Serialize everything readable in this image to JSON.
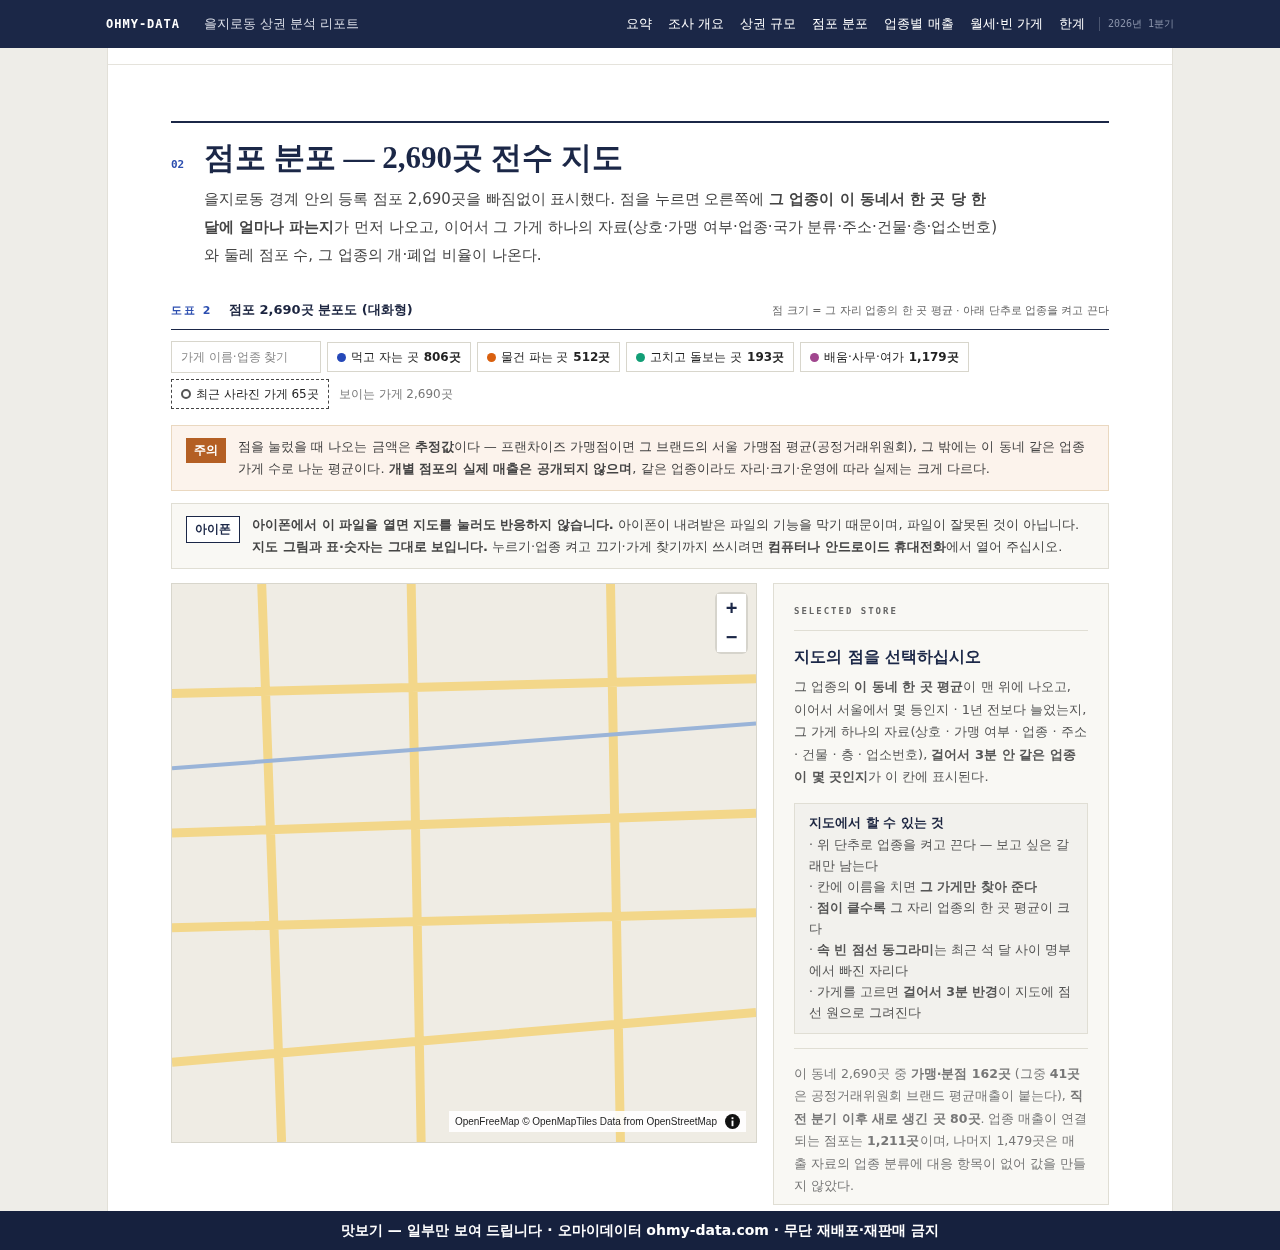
{
  "header": {
    "brand": "OHMY-DATA",
    "subtitle": "을지로동 상권 분석 리포트",
    "nav": [
      "요약",
      "조사 개요",
      "상권 규모",
      "점포 분포",
      "업종별 매출",
      "월세·빈 가게",
      "한계"
    ],
    "period": "2026년 1분기"
  },
  "section": {
    "number": "02",
    "title": "점포 분포 — 2,690곳 전수 지도",
    "intro": "을지로동 경계 안의 등록 점포 2,690곳을 빠짐없이 표시했다. 점을 누르면 오른쪽에 **그 업종이 이 동네서 한 곳 당 한 달에 얼마나 파는지**가 먼저 나오고, 이어서 그 가게 하나의 자료(상호·가맹 여부·업종·국가 분류·주소·건물·층·업소번호)와 둘레 점포 수, 그 업종의 개·폐업 비율이 나온다."
  },
  "figure": {
    "label": "도표 2",
    "title": "점포 2,690곳 분포도 (대화형)",
    "note": "점 크기 = 그 자리 업종의 한 곳 평균 · 아래 단추로 업종을 켜고 끈다"
  },
  "search": {
    "placeholder": "가게 이름·업종 찾기"
  },
  "filters": [
    {
      "kind": "category",
      "label": "먹고 자는 곳",
      "count": "806곳",
      "color": "#2548b8"
    },
    {
      "kind": "category",
      "label": "물건 파는 곳",
      "count": "512곳",
      "color": "#d9600f"
    },
    {
      "kind": "category",
      "label": "고치고 돌보는 곳",
      "count": "193곳",
      "color": "#129e76"
    },
    {
      "kind": "category",
      "label": "배움·사무·여가",
      "count": "1,179곳",
      "color": "#a0468e"
    },
    {
      "kind": "closed",
      "label": "최근 사라진 가게 65곳"
    }
  ],
  "visible_count": "보이는 가게 2,690곳",
  "notices": [
    {
      "kind": "caution",
      "tag": "주의",
      "text": "점을 눌렀을 때 나오는 금액은 **추정값**이다 — 프랜차이즈 가맹점이면 그 브랜드의 서울 가맹점 평균(공정거래위원회), 그 밖에는 이 동네 같은 업종 가게 수로 나눈 평균이다. **개별 점포의 실제 매출은 공개되지 않으며**, 같은 업종이라도 자리·크기·운영에 따라 실제는 크게 다르다."
    },
    {
      "kind": "info",
      "tag": "아이폰",
      "text": "**아이폰에서 이 파일을 열면 지도를 눌러도 반응하지 않습니다.** 아이폰이 내려받은 파일의 기능을 막기 때문이며, 파일이 잘못된 것이 아닙니다. **지도 그림과 표·숫자는 그대로 보입니다.** 누르기·업종 켜고 끄기·가게 찾기까지 쓰시려면 **컴퓨터나 안드로이드 휴대전화**에서 열어 주십시오."
    }
  ],
  "map": {
    "zoom_in": "+",
    "zoom_out": "−",
    "attribution": "OpenFreeMap © OpenMapTiles Data from OpenStreetMap"
  },
  "panel": {
    "eyebrow": "SELECTED STORE",
    "title": "지도의 점을 선택하십시오",
    "body": "그 업종의 **이 동네 한 곳 평균**이 맨 위에 나오고, 이어서 서울에서 몇 등인지 · 1년 전보다 늘었는지, 그 가게 하나의 자료(상호 · 가맹 여부 · 업종 · 주소 · 건물 · 층 · 업소번호), **걸어서 3분 안 같은 업종이 몇 곳인지**가 이 칸에 표시된다.",
    "tips_title": "지도에서 할 수 있는 것",
    "tips": [
      "· 위 단추로 업종을 켜고 끈다 — 보고 싶은 갈래만 남는다",
      "· 칸에 이름을 치면 **그 가게만 찾아 준다**",
      "· **점이 클수록** 그 자리 업종의 한 곳 평균이 크다",
      "· **속 빈 점선 동그라미**는 최근 석 달 사이 명부에서 빠진 자리다",
      "· 가게를 고르면 **걸어서 3분 반경**이 지도에 점선 원으로 그려진다"
    ],
    "stats": "이 동네 2,690곳 중 **가맹·분점 162곳** (그중 **41곳**은 공정거래위원회 브랜드 평균매출이 붙는다), **직전 분기 이후 새로 생긴 곳 80곳**. 업종 매출이 연결되는 점포는 **1,211곳**이며, 나머지 1,479곳은 매출 자료의 업종 분류에 대응 항목이 없어 값을 만들지 않았다."
  },
  "footer": "맛보기 — 일부만 보여 드립니다 · 오마이데이터 ohmy-data.com · 무단 재배포·재판매 금지"
}
